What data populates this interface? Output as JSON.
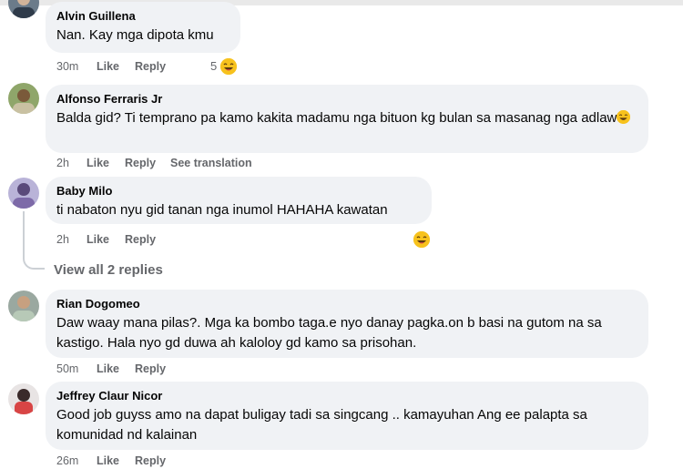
{
  "comments": [
    {
      "author": "Alvin Guillena",
      "text": "Nan. Kay mga dipota kmu",
      "time": "30m",
      "like": "Like",
      "reply": "Reply",
      "reaction_count": "5",
      "reaction_icon": "laughing-emoji-icon"
    },
    {
      "author": "Alfonso Ferraris Jr",
      "text": "Balda gid? Ti temprano pa kamo kakita madamu nga bituon kg bulan sa masanag nga adlaw",
      "time": "2h",
      "like": "Like",
      "reply": "Reply",
      "see_translation": "See translation",
      "inline_icon": "laughing-emoji-icon"
    },
    {
      "author": "Baby Milo",
      "text": "ti nabaton nyu gid tanan nga inumol HAHAHA kawatan",
      "time": "2h",
      "like": "Like",
      "reply": "Reply",
      "reaction_icon": "laughing-emoji-icon"
    },
    {
      "author": "Rian Dogomeo",
      "text": "Daw waay mana pilas?. Mga ka bombo taga.e nyo danay pagka.on b basi na gutom na sa kastigo. Hala nyo gd duwa ah kaloloy gd kamo sa prisohan.",
      "time": "50m",
      "like": "Like",
      "reply": "Reply"
    },
    {
      "author": "Jeffrey Claur Nicor",
      "text": "Good job guyss amo na dapat buligay tadi sa singcang .. kamayuhan Ang ee palapta sa komunidad nd kalainan",
      "time": "26m",
      "like": "Like",
      "reply": "Reply"
    }
  ],
  "view_replies": "View all 2 replies",
  "colors": {
    "bubble": "#f0f2f5",
    "meta": "#65676b",
    "text": "#050505",
    "emoji": "#f7c21d"
  }
}
